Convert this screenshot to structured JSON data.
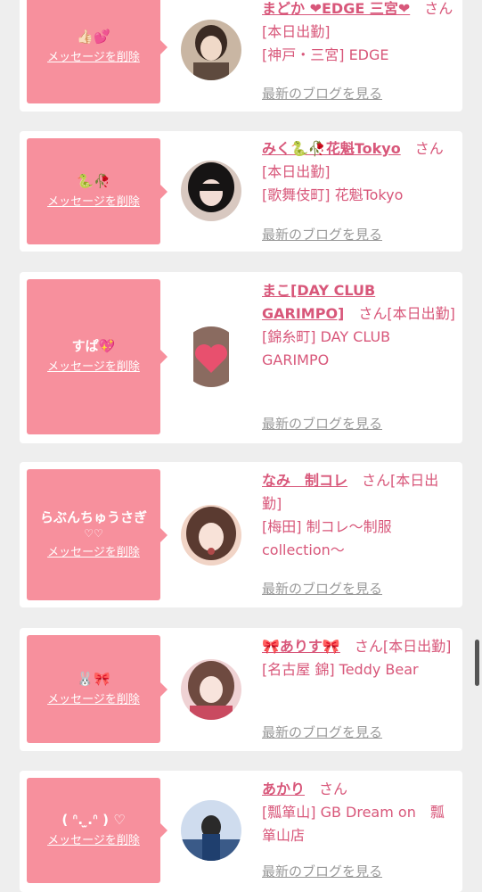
{
  "cards": [
    {
      "nickname": "👍🏻💕",
      "nickname_sub": "",
      "delete_label": "メッセージを削除",
      "name": "まどか ❤EDGE 三宮❤",
      "san_status": "さん[本日出勤]",
      "shop": "[神戸・三宮] EDGE",
      "blog_label": "最新のブログを見る",
      "avatar_colors": [
        "#3a2a22",
        "#c9b6a3"
      ]
    },
    {
      "nickname": "🐍🥀",
      "nickname_sub": "",
      "delete_label": "メッセージを削除",
      "name": "みく🐍🥀花魁Tokyo",
      "san_status": "さん[本日出勤]",
      "shop": "[歌舞伎町] 花魁Tokyo",
      "blog_label": "最新のブログを見る",
      "avatar_colors": [
        "#161414",
        "#d8c8c0"
      ]
    },
    {
      "nickname": "すぱ💖",
      "nickname_sub": "",
      "delete_label": "メッセージを削除",
      "name": "まこ[DAY CLUB GARIMPO]",
      "san_status": "さん[本日出勤]",
      "shop": "[錦糸町] DAY CLUB GARIMPO",
      "blog_label": "最新のブログを見る",
      "avatar_colors": [
        "#8a6b60",
        "#e8506e"
      ]
    },
    {
      "nickname": "らぶんちゅうさぎ",
      "nickname_sub": "♡♡",
      "delete_label": "メッセージを削除",
      "name": "なみ　制コレ",
      "san_status": "さん[本日出勤]",
      "shop": "[梅田] 制コレ〜制服collection〜",
      "blog_label": "最新のブログを見る",
      "avatar_colors": [
        "#5a3a30",
        "#f1d4c6"
      ]
    },
    {
      "nickname": "🐰🎀",
      "nickname_sub": "",
      "delete_label": "メッセージを削除",
      "name": "🎀ありす🎀",
      "san_status": "さん[本日出勤]",
      "shop": "[名古屋 錦] Teddy Bear",
      "blog_label": "最新のブログを見る",
      "avatar_colors": [
        "#6e4a40",
        "#efd2d4"
      ]
    },
    {
      "nickname": "( ᐢ. ̫.ᐢ ) ♡",
      "nickname_sub": "",
      "delete_label": "メッセージを削除",
      "name": "あかり",
      "san_status": "さん",
      "shop": "[瓢箪山] GB Dream on　瓢箪山店",
      "blog_label": "最新のブログを見る",
      "avatar_colors": [
        "#3a5a88",
        "#cfdcee"
      ]
    }
  ]
}
